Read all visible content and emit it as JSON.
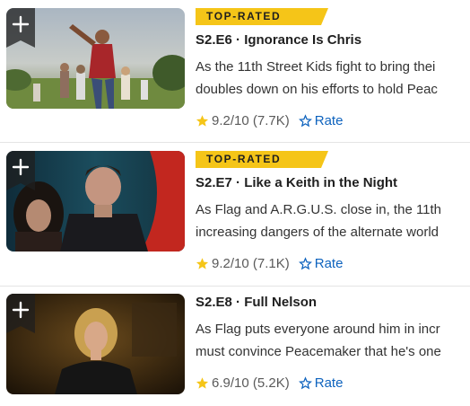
{
  "colors": {
    "badge": "#f5c518",
    "star": "#f5c518",
    "rate_link": "#0e63be"
  },
  "episodes": [
    {
      "badge": "TOP-RATED",
      "title": "S2.E6 · Ignorance Is Chris",
      "desc_line1": "As the 11th Street Kids fight to bring thei",
      "desc_line2": "doubles down on his efforts to hold Peac",
      "rating": "9.2",
      "rating_max": "/10",
      "votes": "(7.7K)",
      "rate_label": "Rate",
      "add_icon": "plus-icon",
      "thumb_alt": "episode-6-still"
    },
    {
      "badge": "TOP-RATED",
      "title": "S2.E7 · Like a Keith in the Night",
      "desc_line1": "As Flag and A.R.G.U.S. close in, the 11th",
      "desc_line2": "increasing dangers of the alternate world",
      "rating": "9.2",
      "rating_max": "/10",
      "votes": "(7.1K)",
      "rate_label": "Rate",
      "add_icon": "plus-icon",
      "thumb_alt": "episode-7-still"
    },
    {
      "badge": "",
      "title": "S2.E8 · Full Nelson",
      "desc_line1": "As Flag puts everyone around him in incr",
      "desc_line2": "must convince Peacemaker that he's one",
      "rating": "6.9",
      "rating_max": "/10",
      "votes": "(5.2K)",
      "rate_label": "Rate",
      "add_icon": "plus-icon",
      "thumb_alt": "episode-8-still"
    }
  ]
}
